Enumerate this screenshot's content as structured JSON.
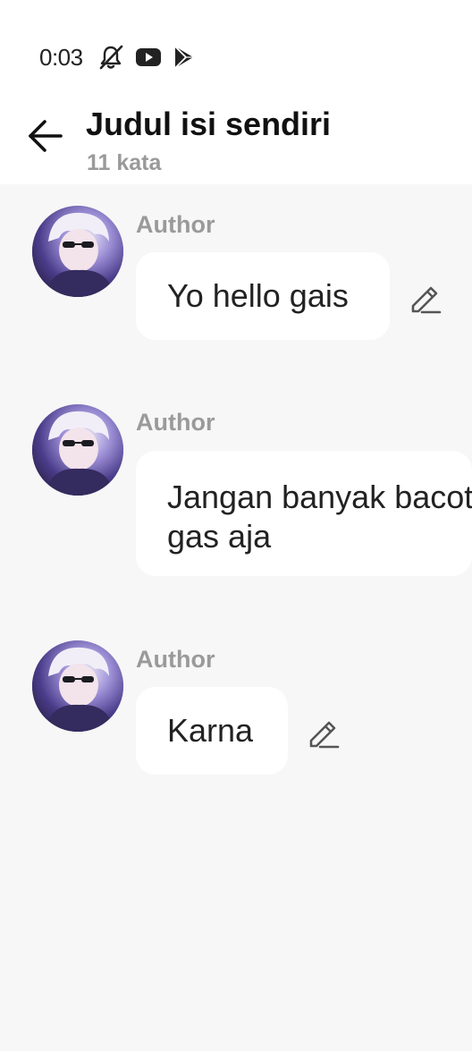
{
  "status_bar": {
    "time": "0:03",
    "icons": [
      "muted-bell-icon",
      "youtube-icon",
      "play-store-icon"
    ]
  },
  "header": {
    "title": "Judul isi sendiri",
    "subtitle": "11 kata",
    "back_icon": "arrow-left-icon"
  },
  "messages": [
    {
      "author": "Author",
      "text": "Yo hello gais",
      "editable": true
    },
    {
      "author": "Author",
      "text": "Jangan banyak bacot\ngas aja",
      "editable": false
    },
    {
      "author": "Author",
      "text": "Karna",
      "editable": true
    }
  ],
  "colors": {
    "background": "#f7f7f7",
    "header_background": "#ffffff",
    "bubble": "#ffffff",
    "muted_text": "#9a9a9a",
    "text": "#222222"
  }
}
